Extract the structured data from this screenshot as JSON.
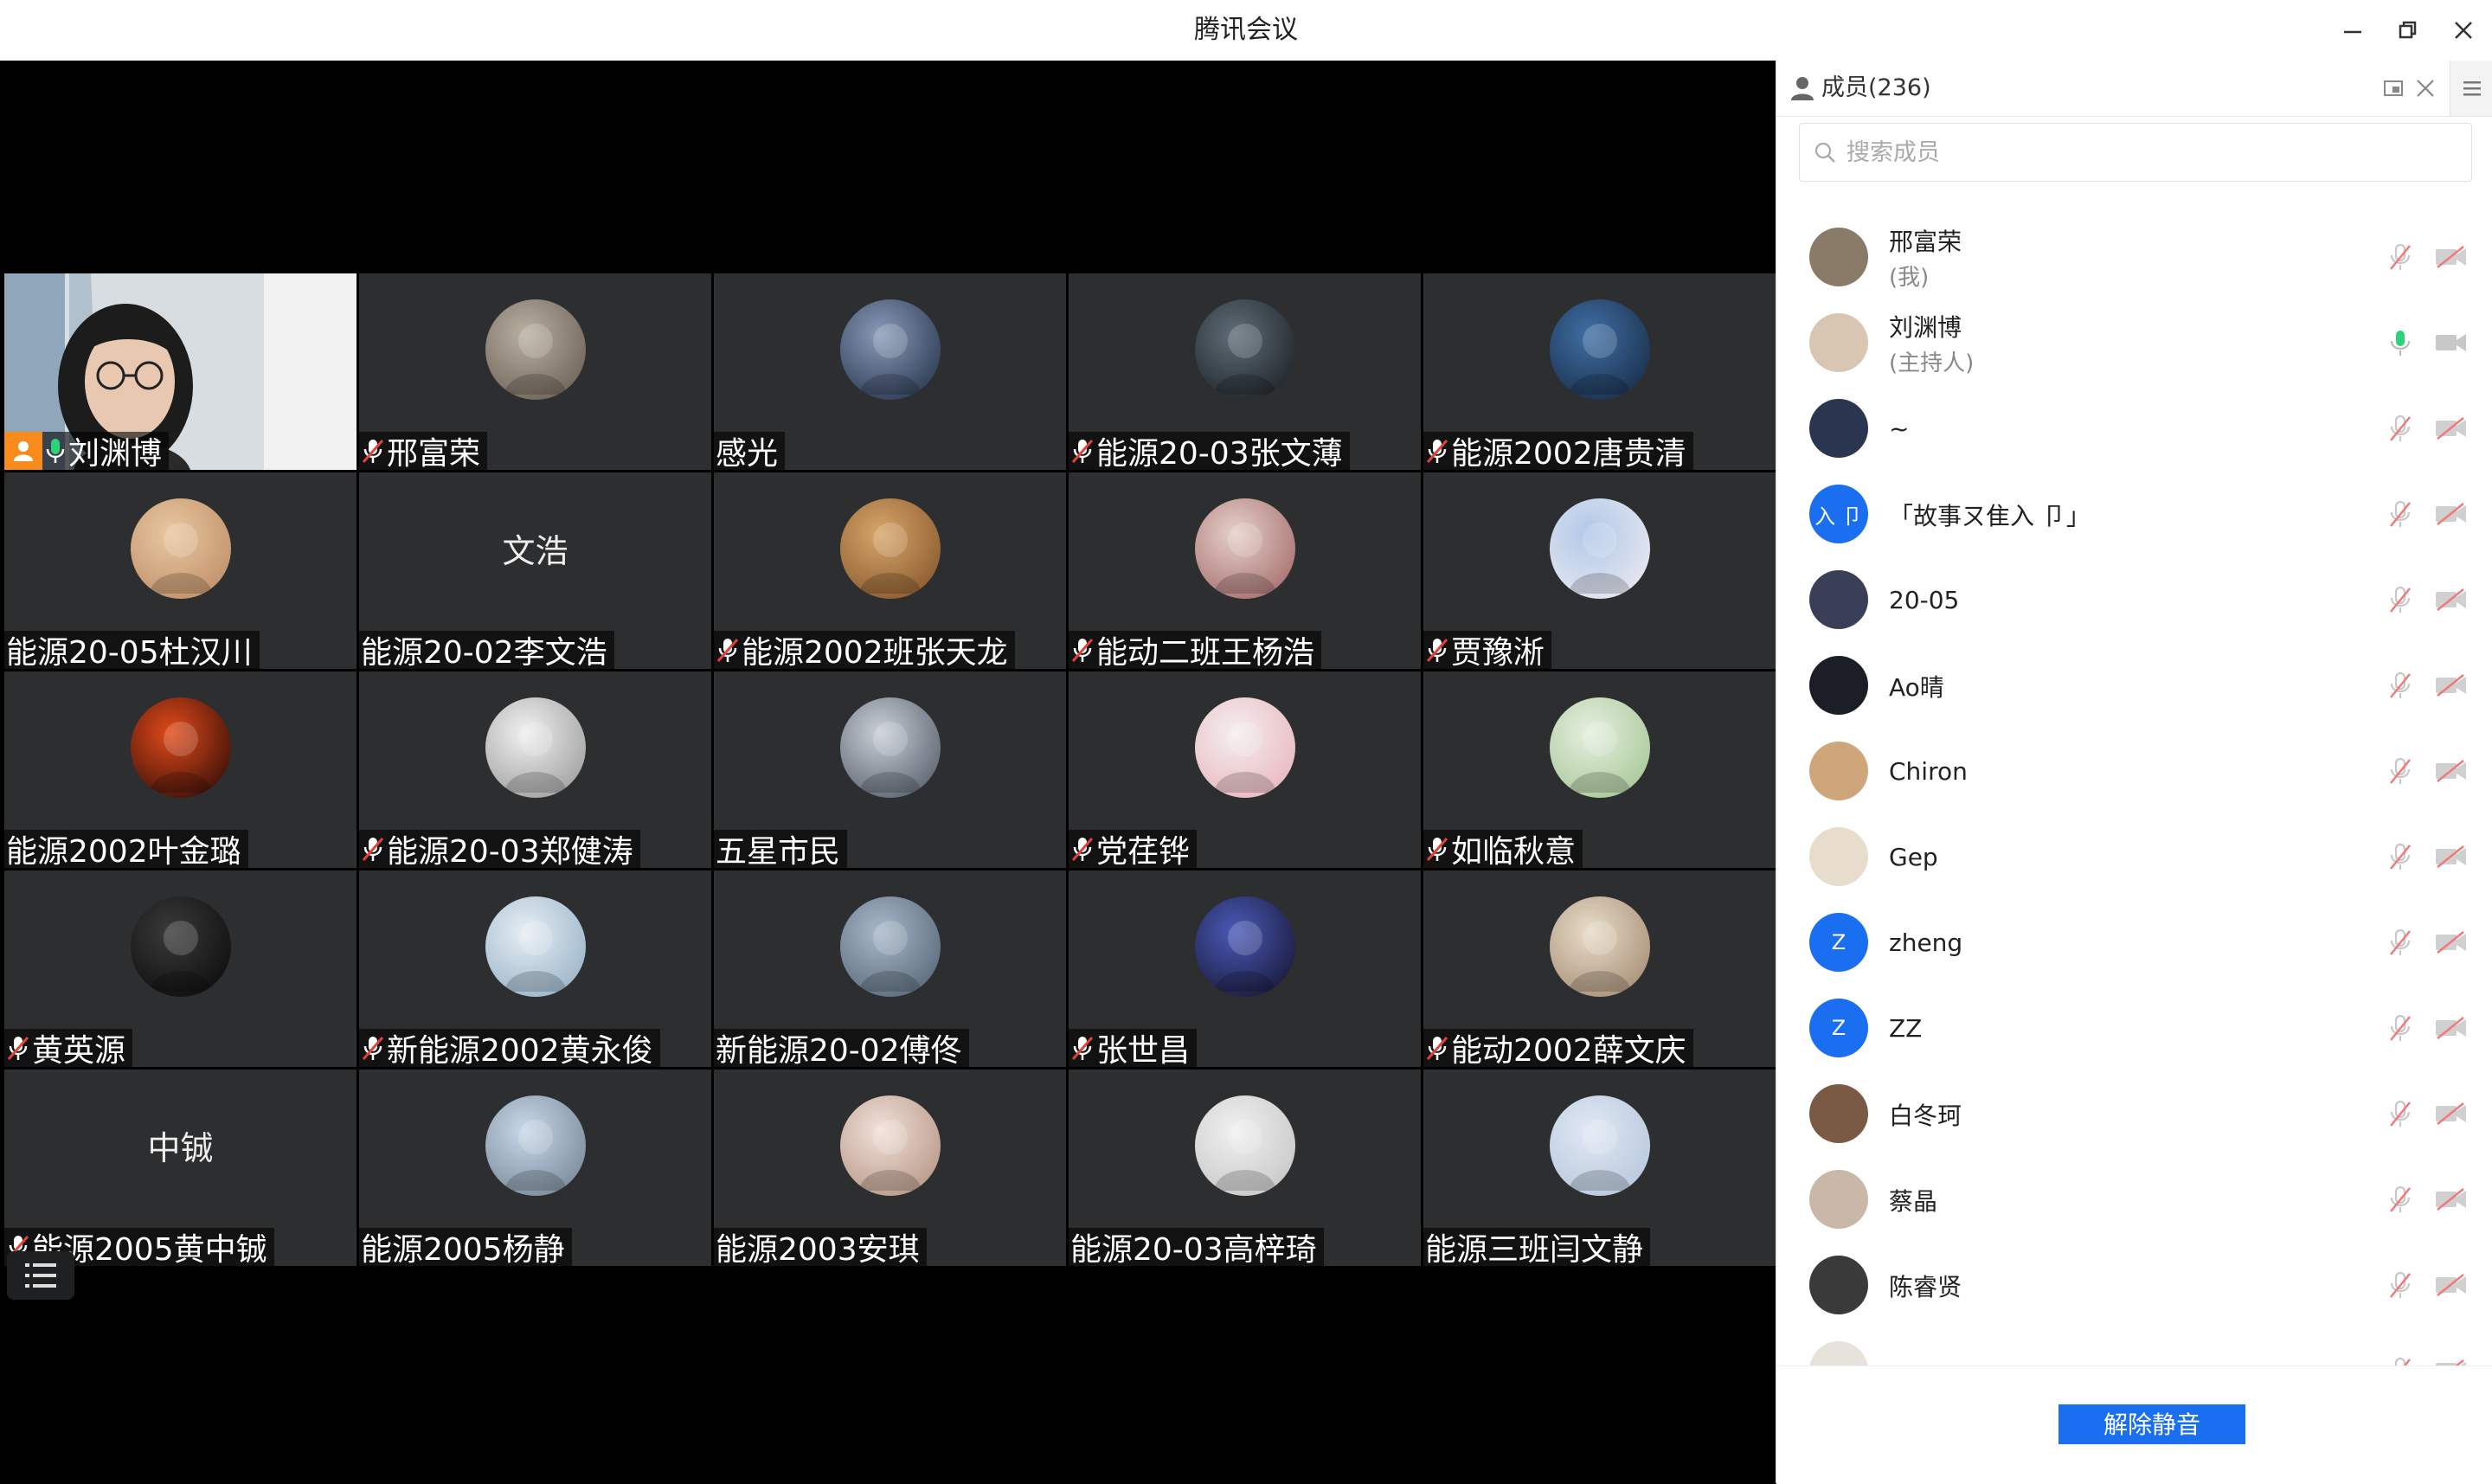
{
  "window": {
    "title": "腾讯会议"
  },
  "colors": {
    "accent": "#1a6ff0",
    "tile_bg": "#2d2e30",
    "muted_red": "#e0433a",
    "mic_green": "#2bd47a",
    "host_orange": "#f98b1b"
  },
  "grid": {
    "tiles": [
      {
        "name": "刘渊博",
        "mic": "on",
        "host": true,
        "video": true
      },
      {
        "name": "邢富荣",
        "mic": "muted",
        "avatar": "photo"
      },
      {
        "name": "感光",
        "mic": "none",
        "avatar": "photo"
      },
      {
        "name": "能源20-03张文薄",
        "mic": "muted",
        "avatar": "photo"
      },
      {
        "name": "能源2002唐贵清",
        "mic": "muted",
        "avatar": "photo"
      },
      {
        "name": "能源20-05杜汉川",
        "mic": "none",
        "avatar": "photo"
      },
      {
        "name": "能源20-02李文浩",
        "mic": "none",
        "text_avatar": "文浩"
      },
      {
        "name": "能源2002班张天龙",
        "mic": "muted",
        "avatar": "photo"
      },
      {
        "name": "能动二班王杨浩",
        "mic": "muted",
        "avatar": "photo"
      },
      {
        "name": "贾豫淅",
        "mic": "muted",
        "avatar": "photo"
      },
      {
        "name": "能源2002叶金璐",
        "mic": "none",
        "avatar": "photo"
      },
      {
        "name": "能源20-03郑健涛",
        "mic": "muted",
        "avatar": "photo"
      },
      {
        "name": "五星市民",
        "mic": "none",
        "avatar": "photo"
      },
      {
        "name": "党荏铧",
        "mic": "muted",
        "avatar": "photo"
      },
      {
        "name": "如临秋意",
        "mic": "muted",
        "avatar": "photo"
      },
      {
        "name": "黄英源",
        "mic": "muted",
        "avatar": "photo"
      },
      {
        "name": "新能源2002黄永俊",
        "mic": "muted",
        "avatar": "photo"
      },
      {
        "name": "新能源20-02傅佟",
        "mic": "none",
        "avatar": "photo"
      },
      {
        "name": "张世昌",
        "mic": "muted",
        "avatar": "photo"
      },
      {
        "name": "能动2002薛文庆",
        "mic": "muted",
        "avatar": "photo"
      },
      {
        "name": "能源2005黄中铖",
        "mic": "muted",
        "text_avatar": "中铖"
      },
      {
        "name": "能源2005杨静",
        "mic": "none",
        "avatar": "photo"
      },
      {
        "name": "能源2003安琪",
        "mic": "none",
        "avatar": "photo"
      },
      {
        "name": "能源20-03高梓琦",
        "mic": "none",
        "avatar": "photo"
      },
      {
        "name": "能源三班闫文静",
        "mic": "none",
        "avatar": "photo"
      }
    ]
  },
  "panel": {
    "title": "成员(236)",
    "search_placeholder": "搜索成员",
    "members": [
      {
        "name": "邢富荣",
        "role": "(我)",
        "avatar_color": "#8a7a68",
        "mic": "muted"
      },
      {
        "name": "刘渊博",
        "role": "(主持人)",
        "avatar_color": "#d9c6b2",
        "mic": "on"
      },
      {
        "name": "~",
        "role": "",
        "avatar_color": "#2a3550",
        "mic": "muted"
      },
      {
        "name": "「故事ㄡ隹入 卩」",
        "role": "",
        "avatar_color": "#1a6ff0",
        "avatar_text": "入 卩",
        "mic": "muted"
      },
      {
        "name": "20-05",
        "role": "",
        "avatar_color": "#3a3f58",
        "mic": "muted"
      },
      {
        "name": "Ao晴",
        "role": "",
        "avatar_color": "#1b1e26",
        "mic": "muted"
      },
      {
        "name": "Chiron",
        "role": "",
        "avatar_color": "#cfa67a",
        "mic": "muted"
      },
      {
        "name": "Gep",
        "role": "",
        "avatar_color": "#e8dccd",
        "mic": "muted"
      },
      {
        "name": "zheng",
        "role": "",
        "avatar_color": "#1a6ff0",
        "avatar_text": "Z",
        "mic": "muted"
      },
      {
        "name": "ZZ",
        "role": "",
        "avatar_color": "#1a6ff0",
        "avatar_text": "Z",
        "mic": "muted"
      },
      {
        "name": "白冬珂",
        "role": "",
        "avatar_color": "#7a5a44",
        "mic": "muted"
      },
      {
        "name": "蔡晶",
        "role": "",
        "avatar_color": "#c9b8a8",
        "mic": "muted"
      },
      {
        "name": "陈睿贤",
        "role": "",
        "avatar_color": "#3a3a3a",
        "mic": "muted"
      },
      {
        "name": "",
        "role": "",
        "avatar_color": "#e8e2dc",
        "mic": "muted"
      }
    ],
    "unmute_label": "解除静音"
  }
}
